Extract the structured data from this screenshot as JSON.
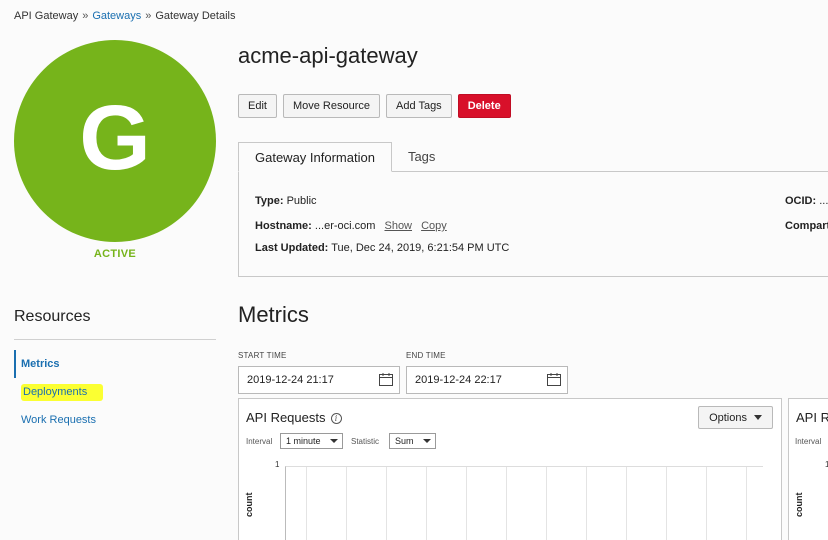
{
  "breadcrumb": {
    "root": "API Gateway",
    "sep1": "»",
    "gateways": "Gateways",
    "sep2": "»",
    "current": "Gateway Details"
  },
  "badge": {
    "letter": "G",
    "status": "ACTIVE",
    "color": "#76b41b"
  },
  "gateway": {
    "name": "acme-api-gateway"
  },
  "actions": {
    "edit": "Edit",
    "move": "Move Resource",
    "tags": "Add Tags",
    "delete": "Delete"
  },
  "tabs": [
    {
      "label": "Gateway Information",
      "active": true
    },
    {
      "label": "Tags",
      "active": false
    }
  ],
  "info": {
    "type_label": "Type:",
    "type_value": "Public",
    "hostname_label": "Hostname:",
    "hostname_value": "...er-oci.com",
    "show": "Show",
    "copy": "Copy",
    "updated_label": "Last Updated:",
    "updated_value": "Tue, Dec 24, 2019, 6:21:54 PM UTC",
    "ocid_label": "OCID:",
    "ocid_value": "...",
    "compartment_label": "Compart"
  },
  "resources": {
    "title": "Resources",
    "items": [
      {
        "label": "Metrics",
        "active": true
      },
      {
        "label": "Deployments",
        "active": false
      },
      {
        "label": "Work Requests",
        "active": false
      }
    ]
  },
  "metrics": {
    "title": "Metrics",
    "start_label": "START TIME",
    "start_value": "2019-12-24 21:17",
    "end_label": "END TIME",
    "end_value": "2019-12-24 22:17"
  },
  "chart_card": {
    "title": "API Requests",
    "options": "Options",
    "interval_label": "Interval",
    "interval_value": "1 minute",
    "statistic_label": "Statistic",
    "statistic_value": "Sum",
    "y_tick_top": "1",
    "y_label": "count"
  },
  "chart_card2": {
    "title": "API R",
    "interval_label": "Interval",
    "y_tick_top": "1",
    "y_label": "count"
  },
  "colors": {
    "link": "#1a6fb0",
    "danger": "#d8102a",
    "active_green": "#76b41b",
    "highlight": "#fbff32"
  }
}
